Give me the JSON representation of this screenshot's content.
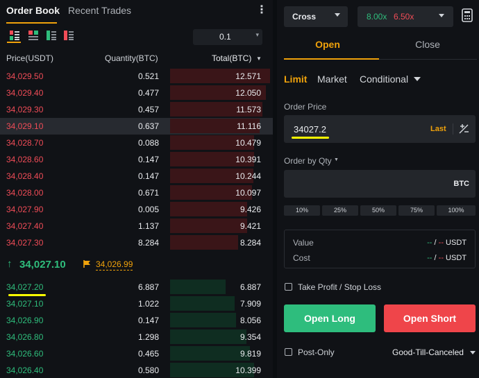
{
  "orderbook": {
    "tabs": [
      "Order Book",
      "Recent Trades"
    ],
    "depth": "0.1",
    "headers": {
      "price": "Price(USDT)",
      "quantity": "Quantity(BTC)",
      "total": "Total(BTC)"
    },
    "asks": [
      {
        "price": "34,029.50",
        "qty": "0.521",
        "total": "12.571",
        "depth": 0.97
      },
      {
        "price": "34,029.40",
        "qty": "0.477",
        "total": "12.050",
        "depth": 0.93
      },
      {
        "price": "34,029.30",
        "qty": "0.457",
        "total": "11.573",
        "depth": 0.9
      },
      {
        "price": "34,029.10",
        "qty": "0.637",
        "total": "11.116",
        "depth": 0.87
      },
      {
        "price": "34,028.70",
        "qty": "0.088",
        "total": "10.479",
        "depth": 0.82
      },
      {
        "price": "34,028.60",
        "qty": "0.147",
        "total": "10.391",
        "depth": 0.82
      },
      {
        "price": "34,028.40",
        "qty": "0.147",
        "total": "10.244",
        "depth": 0.81
      },
      {
        "price": "34,028.00",
        "qty": "0.671",
        "total": "10.097",
        "depth": 0.8
      },
      {
        "price": "34,027.90",
        "qty": "0.005",
        "total": "9.426",
        "depth": 0.75
      },
      {
        "price": "34,027.40",
        "qty": "1.137",
        "total": "9.421",
        "depth": 0.75
      },
      {
        "price": "34,027.30",
        "qty": "8.284",
        "total": "8.284",
        "depth": 0.66
      }
    ],
    "last_price": "34,027.10",
    "mark_price": "34,026.99",
    "bids": [
      {
        "price": "34,027.20",
        "qty": "6.887",
        "total": "6.887",
        "depth": 0.54
      },
      {
        "price": "34,027.10",
        "qty": "1.022",
        "total": "7.909",
        "depth": 0.63
      },
      {
        "price": "34,026.90",
        "qty": "0.147",
        "total": "8.056",
        "depth": 0.64
      },
      {
        "price": "34,026.80",
        "qty": "1.298",
        "total": "9.354",
        "depth": 0.74
      },
      {
        "price": "34,026.60",
        "qty": "0.465",
        "total": "9.819",
        "depth": 0.78
      },
      {
        "price": "34,026.40",
        "qty": "0.580",
        "total": "10.399",
        "depth": 0.82
      }
    ]
  },
  "trade": {
    "margin_mode": "Cross",
    "leverage_long": "8.00x",
    "leverage_short": "6.50x",
    "tabs": {
      "open": "Open",
      "close": "Close"
    },
    "order_types": {
      "limit": "Limit",
      "market": "Market",
      "conditional": "Conditional"
    },
    "price_label": "Order Price",
    "price_value": "34027.2",
    "price_last": "Last",
    "qty_label": "Order by Qty",
    "qty_unit": "BTC",
    "percents": [
      "10%",
      "25%",
      "50%",
      "75%",
      "100%"
    ],
    "value_label": "Value",
    "cost_label": "Cost",
    "value_long": "--",
    "value_sep": "/",
    "value_short": "--",
    "value_unit": "USDT",
    "cost_long": "--",
    "cost_short": "--",
    "cost_unit": "USDT",
    "tpsl_label": "Take Profit / Stop Loss",
    "open_long": "Open Long",
    "open_short": "Open Short",
    "post_only": "Post-Only",
    "time_in_force": "Good-Till-Canceled"
  },
  "colors": {
    "accent": "#f0a20b",
    "up": "#2fbd7c",
    "down": "#f04c57"
  }
}
